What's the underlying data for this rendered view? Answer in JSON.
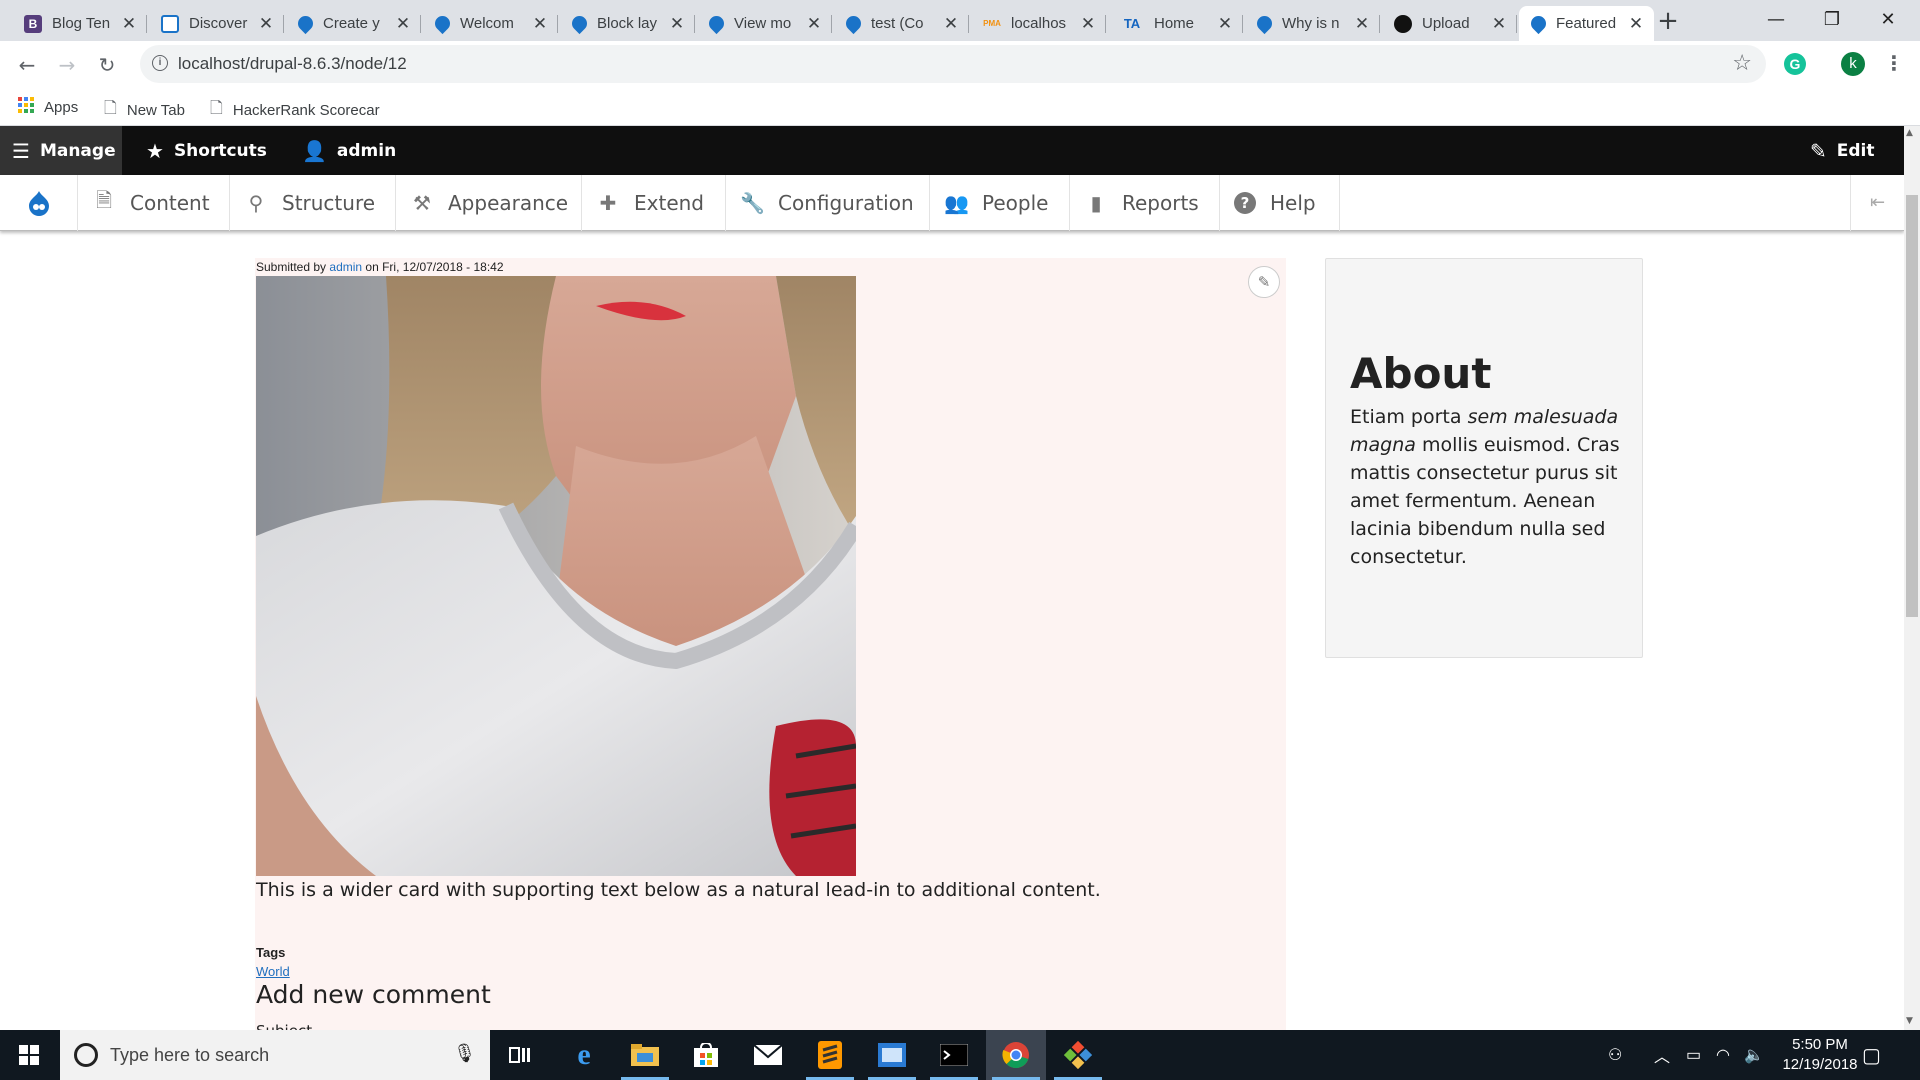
{
  "browser": {
    "tabs": [
      {
        "title": "Blog Ten",
        "favicon": "bootstrap-b",
        "favicon_color": "#563d7c"
      },
      {
        "title": "Discover",
        "favicon": "drupal-box",
        "favicon_color": "#1a73c8"
      },
      {
        "title": "Create y",
        "favicon": "drupal-drop",
        "favicon_color": "#1a73c8"
      },
      {
        "title": "Welcom",
        "favicon": "drupal-drop",
        "favicon_color": "#1a73c8"
      },
      {
        "title": "Block lay",
        "favicon": "drupal-drop",
        "favicon_color": "#1a73c8"
      },
      {
        "title": "View mo",
        "favicon": "drupal-drop",
        "favicon_color": "#1a73c8"
      },
      {
        "title": "test (Co",
        "favicon": "drupal-drop",
        "favicon_color": "#1a73c8"
      },
      {
        "title": "localhos",
        "favicon": "phpmyadmin",
        "favicon_color": "#f29111"
      },
      {
        "title": "Home",
        "favicon": "ta-logo",
        "favicon_color": "#1565c0"
      },
      {
        "title": "Why is n",
        "favicon": "drupal-drop",
        "favicon_color": "#1a73c8"
      },
      {
        "title": "Upload",
        "favicon": "github",
        "favicon_color": "#111111"
      },
      {
        "title": "Featured",
        "favicon": "drupal-drop",
        "favicon_color": "#1a73c8",
        "active": true
      }
    ],
    "favicon_text": {
      "bootstrap": "B",
      "ta": "TA",
      "pma": "PMA"
    },
    "close_glyph": "✕",
    "new_tab_glyph": "+",
    "window_controls": {
      "minimize": "—",
      "maximize": "❐",
      "close": "✕"
    },
    "url": "localhost/drupal-8.6.3/node/12",
    "info_glyph": "i",
    "star_glyph": "☆",
    "profile_initial": "k",
    "extension_initial": "G",
    "bookmarks": [
      {
        "label": "Apps",
        "icon": "apps-grid-icon"
      },
      {
        "label": "New Tab",
        "icon": "page-icon"
      },
      {
        "label": "HackerRank Scorecar",
        "icon": "page-icon"
      }
    ]
  },
  "drupal_toolbar": {
    "manage": "Manage",
    "shortcuts": "Shortcuts",
    "user": "admin",
    "edit": "Edit",
    "tray": [
      {
        "label": "Content",
        "icon": "file-icon"
      },
      {
        "label": "Structure",
        "icon": "sitemap-icon"
      },
      {
        "label": "Appearance",
        "icon": "brush-icon"
      },
      {
        "label": "Extend",
        "icon": "puzzle-icon"
      },
      {
        "label": "Configuration",
        "icon": "wrench-icon"
      },
      {
        "label": "People",
        "icon": "people-icon"
      },
      {
        "label": "Reports",
        "icon": "bar-chart-icon"
      },
      {
        "label": "Help",
        "icon": "help-icon"
      }
    ]
  },
  "node": {
    "submitted_prefix": "Submitted by",
    "author": "admin",
    "submitted_date": "on Fri, 12/07/2018 - 18:42",
    "body": "This is a wider card with supporting text below as a natural lead-in to additional content.",
    "tags_label": "Tags",
    "tag": "World",
    "comment_heading": "Add new comment",
    "subject_label": "Subject",
    "pencil_glyph": "✎"
  },
  "sidebar": {
    "title": "About",
    "body_plain_1": "Etiam porta ",
    "body_em": "sem malesuada magna",
    "body_plain_2": " mollis euismod. Cras mattis consectetur purus sit amet fermentum. Aenean lacinia bibendum nulla sed consectetur."
  },
  "taskbar": {
    "search_placeholder": "Type here to search",
    "time": "5:50 PM",
    "date": "12/19/2018",
    "apps": [
      "task-view",
      "edge",
      "file-explorer",
      "store",
      "mail",
      "sublime-text",
      "outlook-app",
      "terminal",
      "chrome",
      "git"
    ]
  },
  "colors": {
    "drupal_blue": "#1a73c8",
    "link": "#1f6fbf",
    "article_bg": "#fdf3f2",
    "taskbar": "#101820"
  }
}
